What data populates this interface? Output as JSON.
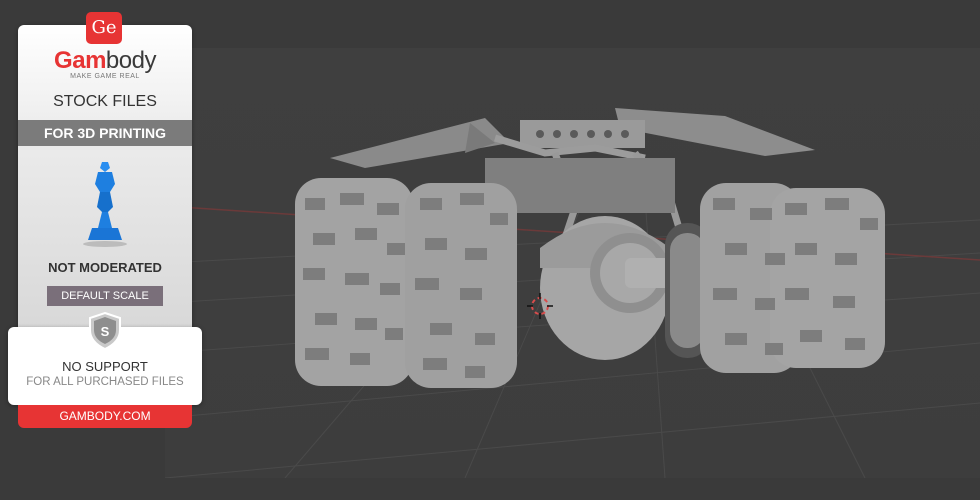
{
  "card": {
    "logo_glyph": "Ge",
    "brand_part1": "Gam",
    "brand_part2": "body",
    "tagline": "MAKE GAME REAL",
    "stock_files": "STOCK FILES",
    "for_printing": "FOR 3D PRINTING",
    "not_moderated": "NOT MODERATED",
    "default_scale": "DEFAULT SCALE",
    "shield_letter": "S",
    "no_support": "NO SUPPORT",
    "purchased_files": "FOR ALL PURCHASED FILES",
    "site": "GAMBODY.COM"
  },
  "colors": {
    "brand_red": "#e73434",
    "band_gray": "#7b7b7b",
    "scale_button": "#7a6f7a",
    "figure_blue": "#1e7fe0",
    "viewport_bg": "#3d3d3d"
  },
  "viewport": {
    "model": "armored-vehicle-model",
    "icons": [
      "3d-cursor-icon"
    ]
  }
}
